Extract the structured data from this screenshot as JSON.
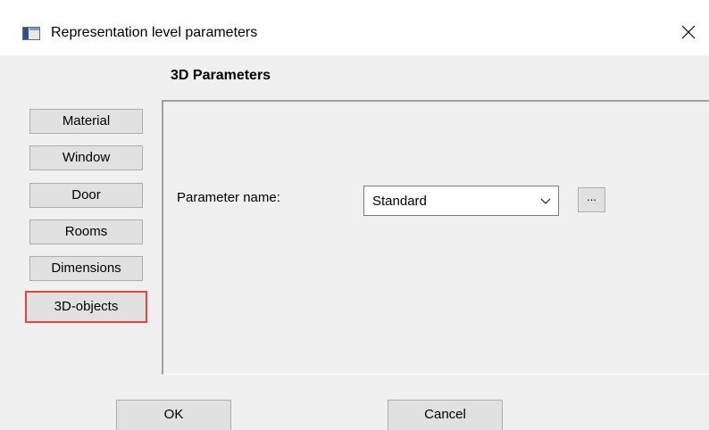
{
  "window": {
    "title": "Representation level parameters",
    "title_icon": "window-app-icon",
    "close_icon": "close-icon"
  },
  "section_title": "3D Parameters",
  "sidebar": {
    "items": [
      {
        "label": "Material"
      },
      {
        "label": "Window"
      },
      {
        "label": "Door"
      },
      {
        "label": "Rooms"
      },
      {
        "label": "Dimensions"
      },
      {
        "label": "3D-objects",
        "selected": true
      }
    ],
    "highlight_color": "#e8433d"
  },
  "parameter": {
    "label": "Parameter name:",
    "value": "Standard",
    "browse_label": "..."
  },
  "footer": {
    "ok_label": "OK",
    "cancel_label": "Cancel"
  }
}
